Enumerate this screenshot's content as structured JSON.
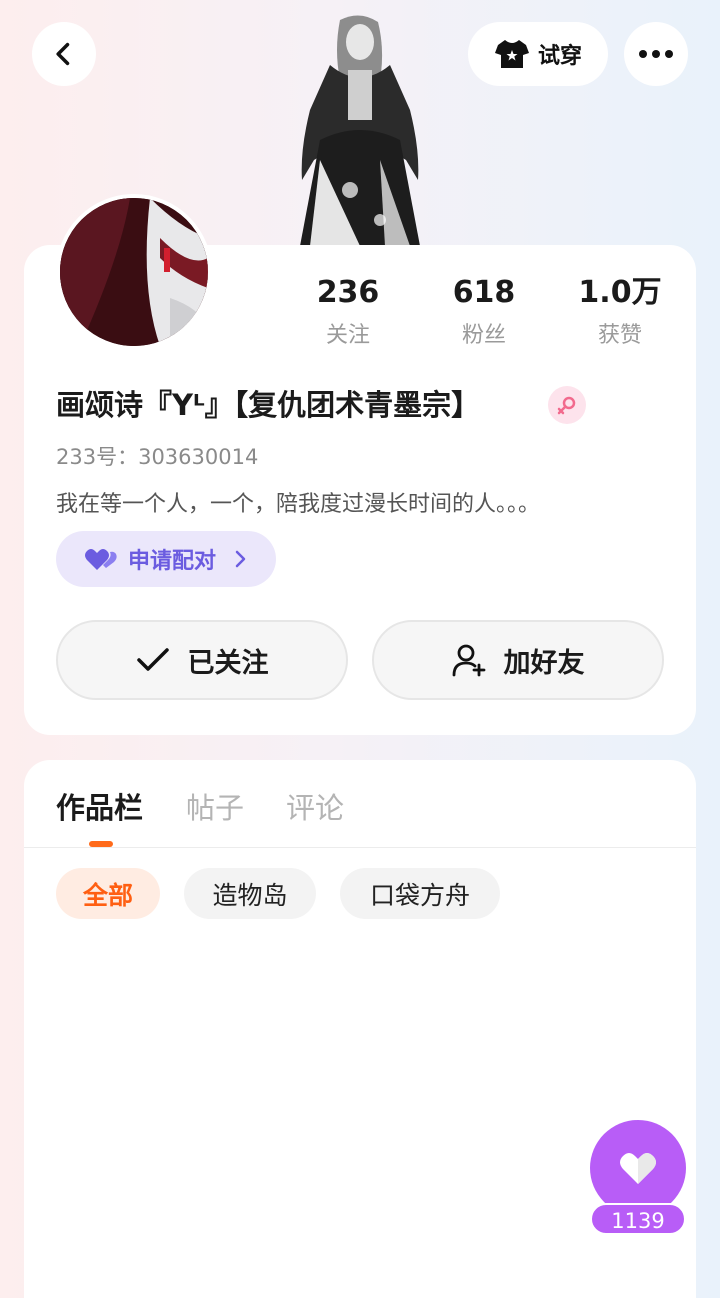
{
  "header": {
    "back_icon": "chevron-left-icon",
    "tryon_label": "试穿",
    "tryon_icon": "tshirt-icon",
    "more_icon": "ellipsis-icon"
  },
  "profile": {
    "stats": [
      {
        "value": "236",
        "label": "关注"
      },
      {
        "value": "618",
        "label": "粉丝"
      },
      {
        "value": "1.0万",
        "label": "获赞"
      }
    ],
    "username": "画颂诗『Yᴸ』【复仇团术青墨宗】",
    "gender": "female",
    "uid": "233号：303630014",
    "bio": "我在等一个人，一个，陪我度过漫长时间的人。。。",
    "pair_label": "申请配对",
    "follow_label": "已关注",
    "add_friend_label": "加好友"
  },
  "works": {
    "tabs": [
      "作品栏",
      "帖子",
      "评论"
    ],
    "active_tab": 0,
    "filters": [
      "全部",
      "造物岛",
      "口袋方舟"
    ],
    "active_filter": 0
  },
  "like": {
    "count": "1139"
  },
  "colors": {
    "accent_orange": "#ff6a1a",
    "pair_purple": "#6b5ce0",
    "like_purple": "#b85df7"
  }
}
